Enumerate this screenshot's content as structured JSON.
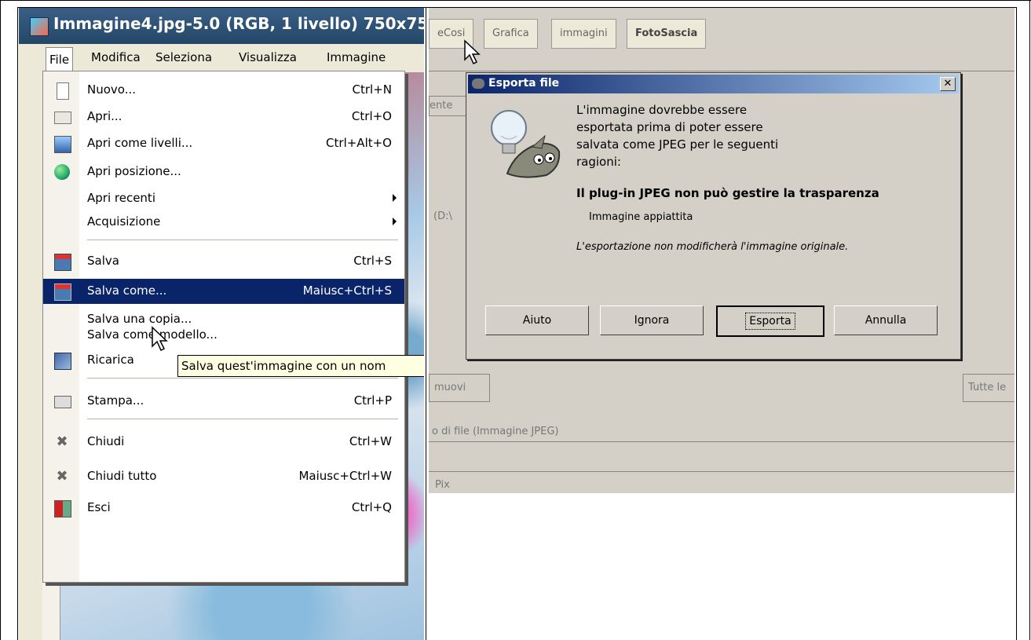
{
  "left_window": {
    "title": "Immagine4.jpg-5.0 (RGB, 1 livello) 750x75",
    "menubar": [
      "File",
      "Modifica",
      "Seleziona",
      "Visualizza",
      "Immagine"
    ],
    "file_menu": [
      {
        "label": "Nuovo...",
        "shortcut": "Ctrl+N",
        "icon": "new-file-icon"
      },
      {
        "label": "Apri...",
        "shortcut": "Ctrl+O",
        "icon": "open-folder-icon"
      },
      {
        "label": "Apri come livelli...",
        "shortcut": "Ctrl+Alt+O",
        "icon": "open-layers-icon"
      },
      {
        "label": "Apri posizione...",
        "shortcut": "",
        "icon": "globe-icon"
      },
      {
        "label": "Apri recenti",
        "shortcut": "",
        "submenu": true
      },
      {
        "label": "Acquisizione",
        "shortcut": "",
        "submenu": true
      },
      {
        "label": "Salva",
        "shortcut": "Ctrl+S",
        "icon": "save-icon"
      },
      {
        "label": "Salva come...",
        "shortcut": "Maiusc+Ctrl+S",
        "icon": "save-as-icon",
        "selected": true
      },
      {
        "label": "Salva una copia...",
        "shortcut": ""
      },
      {
        "label": "Salva come modello...",
        "shortcut": ""
      },
      {
        "label": "Ricarica",
        "shortcut": "",
        "icon": "reload-icon"
      },
      {
        "label": "Stampa...",
        "shortcut": "Ctrl+P",
        "icon": "print-icon"
      },
      {
        "label": "Chiudi",
        "shortcut": "Ctrl+W",
        "icon": "close-icon"
      },
      {
        "label": "Chiudi tutto",
        "shortcut": "Maiusc+Ctrl+W",
        "icon": "close-all-icon"
      },
      {
        "label": "Esci",
        "shortcut": "Ctrl+Q",
        "icon": "quit-icon"
      }
    ],
    "tooltip": "Salva quest'immagine con un nom"
  },
  "right_window": {
    "tabs": [
      "eCosi",
      "Grafica",
      "immagini",
      "FotoSascia"
    ],
    "bg_fragments": {
      "ente": "ente",
      "path": "(D:\\",
      "rimuovi": "muovi",
      "tutte": "Tutte le",
      "tipo": "o di file (Immagine JPEG)",
      "pix": "Pix"
    },
    "dialog": {
      "title": "Esporta file",
      "message": [
        "L'immagine dovrebbe essere",
        "esportata prima di poter essere",
        "salvata come JPEG per le seguenti",
        "ragioni:"
      ],
      "reason": "Il plug-in JPEG non può gestire la trasparenza",
      "detail": "Immagine appiattita",
      "note": "L'esportazione non modificherà l'immagine originale.",
      "buttons": {
        "help": "Aiuto",
        "ignore": "Ignora",
        "export": "Esporta",
        "cancel": "Annulla"
      }
    }
  }
}
